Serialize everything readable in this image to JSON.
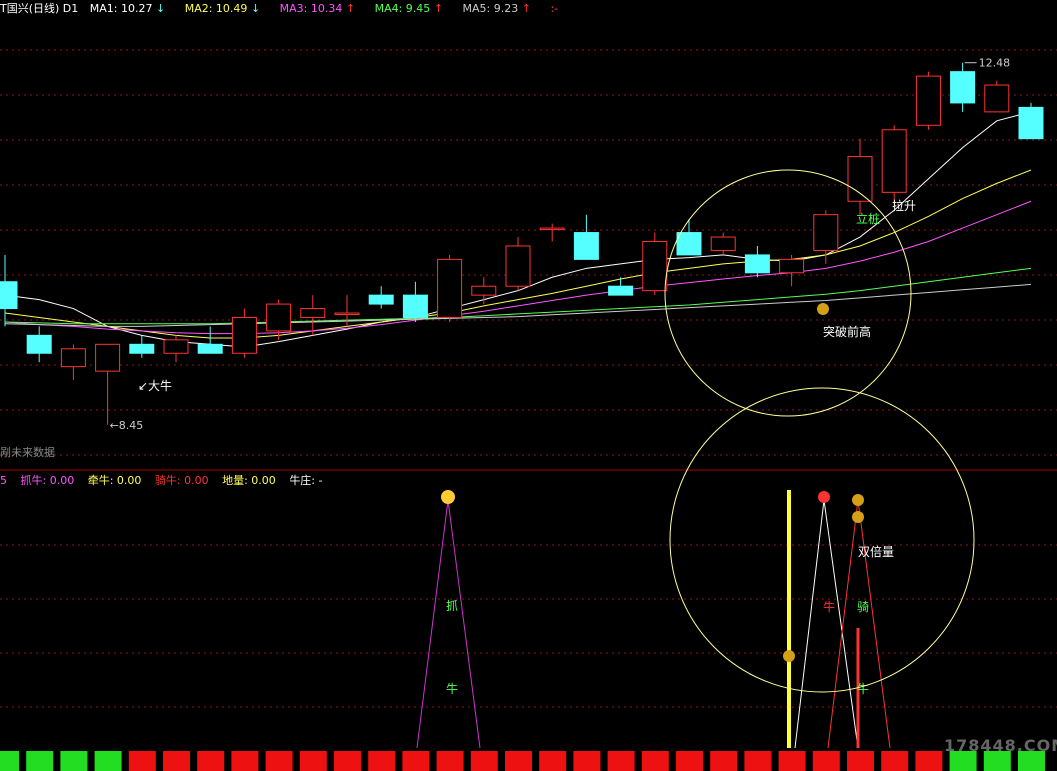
{
  "upper_header": {
    "title": "T国兴(日线) D1",
    "ma": [
      {
        "label": "MA1: 10.27",
        "arrow": "↓",
        "color": "#ffffff"
      },
      {
        "label": "MA2: 10.49",
        "arrow": "↓",
        "color": "#ffff55"
      },
      {
        "label": "MA3: 10.34",
        "arrow": "↑",
        "color": "#ff55ff"
      },
      {
        "label": "MA4: 9.45",
        "arrow": "↑",
        "color": "#55ff55"
      },
      {
        "label": "MA5: 9.23",
        "arrow": "↑",
        "color": "#cccccc"
      },
      {
        "label": ":-",
        "arrow": "",
        "color": "#ff4444"
      }
    ]
  },
  "lower_header": {
    "prefix": "5",
    "items": [
      {
        "label": "抓牛: 0.00",
        "color": "#ff55ff"
      },
      {
        "label": "牵牛: 0.00",
        "color": "#ffff55"
      },
      {
        "label": "骑牛: 0.00",
        "color": "#ff3333"
      },
      {
        "label": "地量: 0.00",
        "color": "#ffff55"
      },
      {
        "label": "牛庄: -",
        "color": "#ffffff"
      }
    ]
  },
  "annotations": {
    "high_label": "12.48",
    "low_label": "8.45",
    "dashniu": "大牛",
    "breakthrough": "突破前高",
    "lizhu": "立桩",
    "lasheng": "拉升",
    "future_data": "剐未来数据",
    "double_volume": "双倍量",
    "zhua": "抓",
    "niu": "牛",
    "qi": "骑",
    "watermark": "178448.COM"
  },
  "colors": {
    "up": "#ff3333",
    "down": "#55ffff",
    "grid": "#8b1a1a",
    "circle": "#ffff99"
  },
  "chart_data": {
    "type": "candlestick",
    "candles": [
      {
        "o": 10.05,
        "h": 10.35,
        "l": 9.55,
        "c": 9.75
      },
      {
        "o": 9.45,
        "h": 9.55,
        "l": 9.15,
        "c": 9.25
      },
      {
        "o": 9.1,
        "h": 9.35,
        "l": 8.95,
        "c": 9.3
      },
      {
        "o": 9.05,
        "h": 9.35,
        "l": 8.45,
        "c": 9.35
      },
      {
        "o": 9.35,
        "h": 9.45,
        "l": 9.2,
        "c": 9.25
      },
      {
        "o": 9.25,
        "h": 9.45,
        "l": 9.15,
        "c": 9.4
      },
      {
        "o": 9.35,
        "h": 9.55,
        "l": 9.25,
        "c": 9.25
      },
      {
        "o": 9.25,
        "h": 9.75,
        "l": 9.2,
        "c": 9.65
      },
      {
        "o": 9.5,
        "h": 9.85,
        "l": 9.4,
        "c": 9.8
      },
      {
        "o": 9.65,
        "h": 9.9,
        "l": 9.45,
        "c": 9.75
      },
      {
        "o": 9.7,
        "h": 9.9,
        "l": 9.55,
        "c": 9.7
      },
      {
        "o": 9.9,
        "h": 10.0,
        "l": 9.75,
        "c": 9.8
      },
      {
        "o": 9.9,
        "h": 10.05,
        "l": 9.6,
        "c": 9.65
      },
      {
        "o": 9.65,
        "h": 10.35,
        "l": 9.6,
        "c": 10.3
      },
      {
        "o": 9.9,
        "h": 10.1,
        "l": 9.8,
        "c": 10.0
      },
      {
        "o": 10.0,
        "h": 10.55,
        "l": 9.95,
        "c": 10.45
      },
      {
        "o": 10.65,
        "h": 10.7,
        "l": 10.5,
        "c": 10.65
      },
      {
        "o": 10.6,
        "h": 10.8,
        "l": 10.3,
        "c": 10.3
      },
      {
        "o": 10.0,
        "h": 10.1,
        "l": 9.9,
        "c": 9.9
      },
      {
        "o": 9.95,
        "h": 10.6,
        "l": 9.9,
        "c": 10.5
      },
      {
        "o": 10.6,
        "h": 10.75,
        "l": 10.35,
        "c": 10.35
      },
      {
        "o": 10.4,
        "h": 10.6,
        "l": 10.35,
        "c": 10.55
      },
      {
        "o": 10.35,
        "h": 10.45,
        "l": 10.1,
        "c": 10.15
      },
      {
        "o": 10.15,
        "h": 10.35,
        "l": 10.0,
        "c": 10.3
      },
      {
        "o": 10.4,
        "h": 10.85,
        "l": 10.25,
        "c": 10.8
      },
      {
        "o": 10.95,
        "h": 11.65,
        "l": 10.8,
        "c": 11.45
      },
      {
        "o": 11.05,
        "h": 11.8,
        "l": 10.9,
        "c": 11.75
      },
      {
        "o": 11.8,
        "h": 12.4,
        "l": 11.75,
        "c": 12.35
      },
      {
        "o": 12.4,
        "h": 12.5,
        "l": 11.95,
        "c": 12.05
      },
      {
        "o": 11.95,
        "h": 12.3,
        "l": 11.95,
        "c": 12.25
      },
      {
        "o": 12.0,
        "h": 12.05,
        "l": 11.65,
        "c": 11.65
      }
    ],
    "ma_lines": [
      {
        "name": "MA1",
        "color": "#ffffff",
        "values": [
          9.9,
          9.85,
          9.75,
          9.55,
          9.45,
          9.38,
          9.35,
          9.32,
          9.38,
          9.45,
          9.52,
          9.6,
          9.65,
          9.75,
          9.85,
          9.95,
          10.1,
          10.2,
          10.25,
          10.3,
          10.32,
          10.35,
          10.3,
          10.28,
          10.35,
          10.55,
          10.85,
          11.2,
          11.55,
          11.85,
          11.95
        ]
      },
      {
        "name": "MA2",
        "color": "#ffff55",
        "values": [
          9.7,
          9.65,
          9.6,
          9.55,
          9.5,
          9.45,
          9.42,
          9.42,
          9.45,
          9.5,
          9.55,
          9.6,
          9.65,
          9.7,
          9.78,
          9.85,
          9.92,
          10.0,
          10.08,
          10.15,
          10.2,
          10.25,
          10.28,
          10.3,
          10.35,
          10.45,
          10.6,
          10.78,
          10.98,
          11.15,
          11.3
        ]
      },
      {
        "name": "MA3",
        "color": "#ff55ff",
        "values": [
          9.6,
          9.57,
          9.55,
          9.52,
          9.5,
          9.48,
          9.47,
          9.47,
          9.48,
          9.5,
          9.53,
          9.57,
          9.62,
          9.67,
          9.72,
          9.78,
          9.84,
          9.9,
          9.95,
          10.0,
          10.04,
          10.08,
          10.12,
          10.15,
          10.2,
          10.28,
          10.38,
          10.5,
          10.65,
          10.8,
          10.95
        ]
      },
      {
        "name": "MA4",
        "color": "#55ff55",
        "values": [
          9.6,
          9.59,
          9.58,
          9.58,
          9.58,
          9.58,
          9.58,
          9.59,
          9.6,
          9.61,
          9.62,
          9.63,
          9.64,
          9.65,
          9.67,
          9.69,
          9.71,
          9.73,
          9.75,
          9.77,
          9.79,
          9.82,
          9.85,
          9.88,
          9.91,
          9.95,
          10.0,
          10.05,
          10.1,
          10.15,
          10.2
        ]
      },
      {
        "name": "MA5",
        "color": "#cccccc",
        "values": [
          9.58,
          9.57,
          9.56,
          9.55,
          9.55,
          9.56,
          9.57,
          9.58,
          9.59,
          9.6,
          9.61,
          9.62,
          9.63,
          9.64,
          9.65,
          9.66,
          9.68,
          9.7,
          9.72,
          9.74,
          9.76,
          9.78,
          9.8,
          9.82,
          9.84,
          9.87,
          9.9,
          9.93,
          9.96,
          9.99,
          10.02
        ]
      }
    ],
    "indicator_signals": [
      {
        "name": "抓牛",
        "index": 13,
        "color": "#ff55ff"
      },
      {
        "name": "牵牛",
        "index": 23,
        "color": "#ffff55"
      },
      {
        "name": "牛",
        "index": 24,
        "color": "#ffffff"
      },
      {
        "name": "骑牛",
        "index": 25,
        "color": "#ff3333"
      }
    ],
    "bottom_bar": [
      "g",
      "g",
      "g",
      "g",
      "r",
      "r",
      "r",
      "r",
      "r",
      "r",
      "r",
      "r",
      "r",
      "r",
      "r",
      "r",
      "r",
      "r",
      "r",
      "r",
      "r",
      "r",
      "r",
      "r",
      "r",
      "r",
      "r",
      "r",
      "g",
      "g",
      "g"
    ]
  }
}
